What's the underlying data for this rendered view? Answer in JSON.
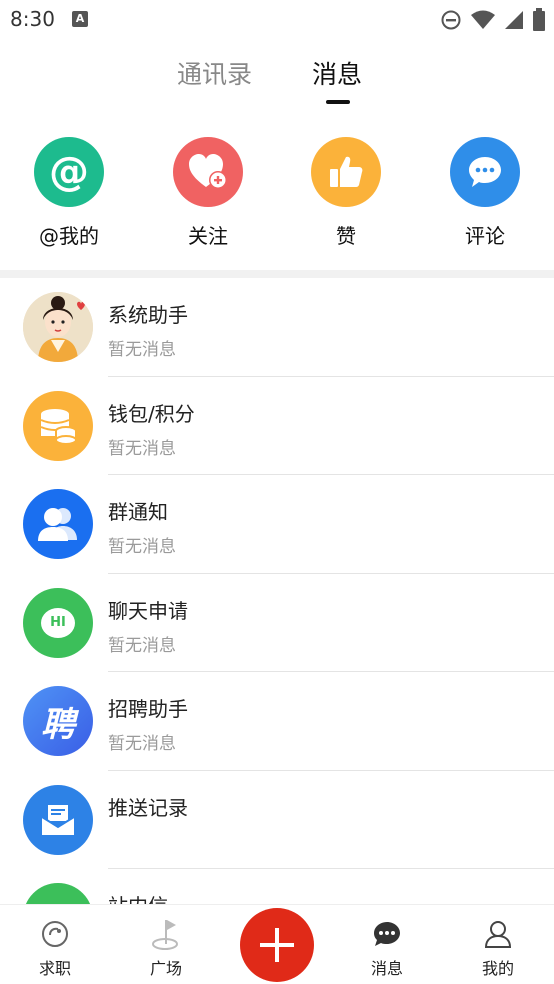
{
  "status_bar": {
    "time": "8:30",
    "notification_glyph": "A"
  },
  "tabs": {
    "contacts": "通讯录",
    "messages": "消息"
  },
  "quick_actions": [
    {
      "label": "@我的",
      "icon": "at-icon",
      "color": "#1dbb8e"
    },
    {
      "label": "关注",
      "icon": "heart-plus-icon",
      "color": "#f06262"
    },
    {
      "label": "赞",
      "icon": "thumbs-up-icon",
      "color": "#fbb23a"
    },
    {
      "label": "评论",
      "icon": "comment-icon",
      "color": "#2f8ee9"
    }
  ],
  "messages": [
    {
      "title": "系统助手",
      "subtitle": "暂无消息",
      "icon": "system-assistant-avatar"
    },
    {
      "title": "钱包/积分",
      "subtitle": "暂无消息",
      "icon": "wallet-coins-icon",
      "color": "#fbb23a"
    },
    {
      "title": "群通知",
      "subtitle": "暂无消息",
      "icon": "group-icon",
      "color": "#1a6ff0"
    },
    {
      "title": "聊天申请",
      "subtitle": "暂无消息",
      "icon": "chat-hi-icon",
      "color": "#3cbf5a",
      "glyph": "HI"
    },
    {
      "title": "招聘助手",
      "subtitle": "暂无消息",
      "icon": "recruit-icon",
      "color": "#3b78f0",
      "glyph": "聘"
    },
    {
      "title": "推送记录",
      "subtitle": "",
      "icon": "push-mail-icon",
      "color": "#2d82e6"
    },
    {
      "title": "站内信",
      "subtitle": "",
      "icon": "site-mail-icon",
      "color": "#3cbf5a"
    }
  ],
  "bottom_nav": {
    "jobs": "求职",
    "square": "广场",
    "plus": "+",
    "messages": "消息",
    "mine": "我的"
  }
}
